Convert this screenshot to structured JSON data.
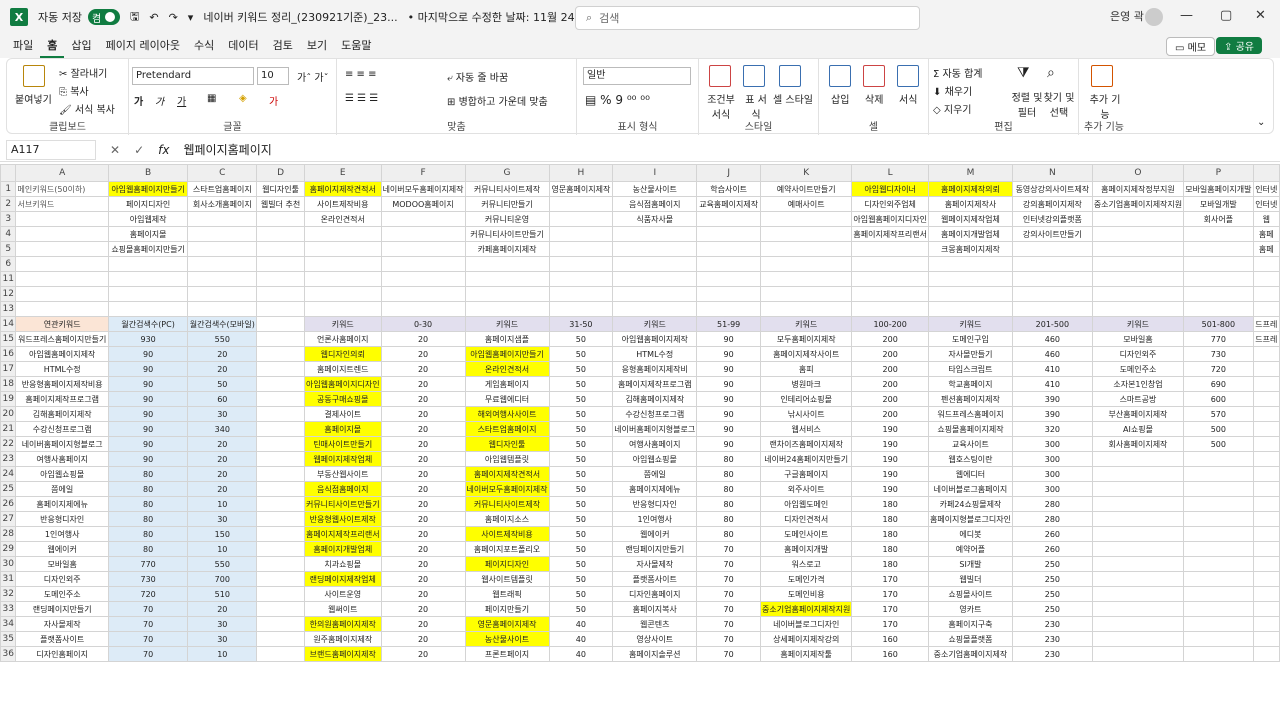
{
  "title": {
    "autosave": "자동 저장",
    "toggle": "켬",
    "filename": "네이버 키워드 정리_(230921기준)_23...",
    "modified": "• 마지막으로 수정한 날짜: 11월 24일",
    "search": "검색",
    "user": "은영 곽"
  },
  "menu": [
    "파일",
    "홈",
    "삽입",
    "페이지 레이아웃",
    "수식",
    "데이터",
    "검토",
    "보기",
    "도움말"
  ],
  "memo": "메모",
  "share": "공유",
  "ribbon": {
    "clipboard": {
      "paste": "붙여넣기",
      "cut": "잘라내기",
      "copy": "복사",
      "format": "서식 복사",
      "label": "클립보드"
    },
    "font": {
      "name": "Pretendard",
      "size": "10",
      "label": "글꼴"
    },
    "align": {
      "wrap": "자동 줄 바꿈",
      "merge": "병합하고 가운데 맞춤",
      "label": "맞춤"
    },
    "number": {
      "format": "일반",
      "label": "표시 형식"
    },
    "style": {
      "cond": "조건부 서식",
      "table": "표 서식",
      "cell": "셀 스타일",
      "label": "스타일"
    },
    "cells": {
      "insert": "삽입",
      "delete": "삭제",
      "format": "서식",
      "label": "셀"
    },
    "edit": {
      "sum": "자동 합계",
      "fill": "채우기",
      "clear": "지우기",
      "sort": "정렬 및 필터",
      "find": "찾기 및 선택",
      "label": "편집"
    },
    "addin": {
      "btn": "추가 기능",
      "label": "추가 기능"
    }
  },
  "formula": {
    "cell": "A117",
    "value": "웹페이지홈페이지"
  },
  "columns": [
    "A",
    "B",
    "C",
    "D",
    "E",
    "F",
    "G",
    "H",
    "I",
    "J",
    "K",
    "L",
    "M",
    "N",
    "O",
    "P",
    ""
  ],
  "top": [
    {
      "r": "1",
      "c": [
        "메인키워드(50이하)",
        "아임웹홈페이지만들기",
        "스타트업홈페이지",
        "웹디자인툴",
        "홈페이지제작견적서",
        "네이버모두홈페이지제작",
        "커뮤니티사이트제작",
        "영문홈페이지제작",
        "농산물사이트",
        "학습사이트",
        "예약사이트만들기",
        "아임웹디자이너",
        "홈페이지제작의뢰",
        "동영상강의사이트제작",
        "홈페이지제작정부지원",
        "모바일홈페이지개발",
        "인터넷"
      ]
    },
    {
      "r": "2",
      "c": [
        "서브키워드",
        "페이지디자인",
        "회사소개홈페이지",
        "웹빌더 추천",
        "사이트제작비용",
        "MODOO홈페이지",
        "커뮤니티만들기",
        "",
        "음식점홈페이지",
        "교육홈페이지제작",
        "예매사이트",
        "디자인외주업체",
        "홈페이지제작사",
        "강의홈페이지제작",
        "중소기업홈페이지제작지원",
        "모바일개발",
        "인터넷"
      ]
    },
    {
      "r": "3",
      "c": [
        "",
        "아임웹제작",
        "",
        "",
        "온라인견적서",
        "",
        "커뮤니티운영",
        "",
        "식품자사몰",
        "",
        "",
        "아임웹홈페이지디자인",
        "웹페이지제작업체",
        "인터넷강의플랫폼",
        "",
        "회사어플",
        "웹"
      ]
    },
    {
      "r": "4",
      "c": [
        "",
        "홈페이지몰",
        "",
        "",
        "",
        "",
        "커뮤니티사이트만들기",
        "",
        "",
        "",
        "",
        "홈페이지제작프리랜서",
        "홈페이지개발업체",
        "강의사이트만들기",
        "",
        "",
        "홈페"
      ]
    },
    {
      "r": "5",
      "c": [
        "",
        "쇼핑몰홈페이지만들기",
        "",
        "",
        "",
        "",
        "카페홈페이지제작",
        "",
        "",
        "",
        "",
        "",
        "크몽홈페이지제작",
        "",
        "",
        "",
        "홈페"
      ]
    },
    {
      "r": "6",
      "c": [
        "",
        "",
        "",
        "",
        "",
        "",
        "",
        "",
        "",
        "",
        "",
        "",
        "",
        "",
        "",
        "",
        ""
      ]
    }
  ],
  "gapRows": [
    "11",
    "12",
    "13"
  ],
  "tableHeader": {
    "r": "14",
    "c": [
      "연관키워드",
      "월간검색수(PC)",
      "월간검색수(모바일)",
      "",
      "키워드",
      "0-30",
      "키워드",
      "31-50",
      "키워드",
      "51-99",
      "키워드",
      "100-200",
      "키워드",
      "201-500",
      "키워드",
      "501-800",
      "드프레"
    ]
  },
  "rows": [
    {
      "r": "15",
      "c": [
        "워드프레스홈페이지만들기",
        "930",
        "550",
        "",
        "언론사홈페이지",
        "20",
        "홈페이지샘플",
        "50",
        "아임웹홈페이지제작",
        "90",
        "모두홈페이지제작",
        "200",
        "도메인구입",
        "460",
        "모바일홈",
        "770",
        "드프레"
      ]
    },
    {
      "r": "16",
      "c": [
        "아임웹홈페이지제작",
        "90",
        "20",
        "",
        "웹디자인의뢰",
        "20",
        "아임웹홈페이지만들기",
        "50",
        "HTML수정",
        "90",
        "홈페이지제작사이트",
        "200",
        "자사몰만들기",
        "460",
        "디자인외주",
        "730",
        ""
      ]
    },
    {
      "r": "17",
      "c": [
        "HTML수정",
        "90",
        "20",
        "",
        "홈페이지트렌드",
        "20",
        "온라인견적서",
        "50",
        "응형홈페이지제작비",
        "90",
        "홈피",
        "200",
        "타입스크립트",
        "410",
        "도메인주소",
        "720",
        ""
      ]
    },
    {
      "r": "18",
      "c": [
        "반응형홈페이지제작비용",
        "90",
        "50",
        "",
        "아임웹홈페이지디자인",
        "20",
        "게임홈페이지",
        "50",
        "홈페이지제작프로그램",
        "90",
        "병원마크",
        "200",
        "학교홈페이지",
        "410",
        "소자본1인창업",
        "690",
        ""
      ]
    },
    {
      "r": "19",
      "c": [
        "홈페이지제작프로그램",
        "90",
        "60",
        "",
        "공동구매쇼핑몰",
        "20",
        "무료웹에디터",
        "50",
        "김해홈페이지제작",
        "90",
        "인테리어쇼핑몰",
        "200",
        "펜션홈페이지제작",
        "390",
        "스마트공방",
        "600",
        ""
      ]
    },
    {
      "r": "20",
      "c": [
        "김해홈페이지제작",
        "90",
        "30",
        "",
        "결제사이트",
        "20",
        "해외여행사사이트",
        "50",
        "수강신청프로그램",
        "90",
        "낚시사이트",
        "200",
        "워드프레스홈페이지",
        "390",
        "부산홈페이지제작",
        "570",
        ""
      ]
    },
    {
      "r": "21",
      "c": [
        "수강신청프로그램",
        "90",
        "340",
        "",
        "홈페이지몰",
        "20",
        "스타트업홈페이지",
        "50",
        "네이버홈페이지형블로그",
        "90",
        "웹서비스",
        "190",
        "쇼핑몰홈페이지제작",
        "320",
        "AI쇼핑몰",
        "500",
        ""
      ]
    },
    {
      "r": "22",
      "c": [
        "네이버홈페이지형블로그",
        "90",
        "20",
        "",
        "틴매사이트만들기",
        "20",
        "웹디자인툴",
        "50",
        "여행사홈페이지",
        "90",
        "랜차이즈홈페이지제작",
        "190",
        "교육사이트",
        "300",
        "회사홈페이지제작",
        "500",
        ""
      ]
    },
    {
      "r": "23",
      "c": [
        "여행사홈페이지",
        "90",
        "20",
        "",
        "웹페이지제작업체",
        "20",
        "아임웹템플릿",
        "50",
        "아임웹쇼핑몰",
        "80",
        "네이버24홈페이지만들기",
        "190",
        "웹호스팅이란",
        "300",
        "",
        "",
        ""
      ]
    },
    {
      "r": "24",
      "c": [
        "아임웹쇼핑몰",
        "80",
        "20",
        "",
        "부동산웹사이트",
        "20",
        "홈페이지제작견적서",
        "50",
        "쯤에일",
        "80",
        "구글홈페이지",
        "190",
        "웹에디터",
        "300",
        "",
        "",
        ""
      ]
    },
    {
      "r": "25",
      "c": [
        "쯤에일",
        "80",
        "20",
        "",
        "음식점홈페이지",
        "20",
        "네이버모두홈페이지제작",
        "50",
        "홈페이지제에뉴",
        "80",
        "외주사이트",
        "190",
        "네이버블로그홈페이지",
        "300",
        "",
        "",
        ""
      ]
    },
    {
      "r": "26",
      "c": [
        "홈페이지제에뉴",
        "80",
        "10",
        "",
        "커뮤니티사이트만들기",
        "20",
        "커뮤니티사이트제작",
        "50",
        "반응형디자인",
        "80",
        "아임웹도메인",
        "180",
        "카페24쇼핑몰제작",
        "280",
        "",
        "",
        ""
      ]
    },
    {
      "r": "27",
      "c": [
        "반응형디자인",
        "80",
        "30",
        "",
        "반응형웹사이트제작",
        "20",
        "홈페이지소스",
        "50",
        "1인여행사",
        "80",
        "디자인견적서",
        "180",
        "홈페이지형블로그디자인",
        "280",
        "",
        "",
        ""
      ]
    },
    {
      "r": "28",
      "c": [
        "1인여행사",
        "80",
        "150",
        "",
        "홈페이지제작프리랜서",
        "20",
        "사이트제작비용",
        "50",
        "웹에이커",
        "80",
        "도메인사이트",
        "180",
        "에디봇",
        "260",
        "",
        "",
        ""
      ]
    },
    {
      "r": "29",
      "c": [
        "웹에이커",
        "80",
        "10",
        "",
        "홈페이지개발업체",
        "20",
        "홈페이지포트폴리오",
        "50",
        "랜딩페이지만들기",
        "70",
        "홈페이지개발",
        "180",
        "예약어플",
        "260",
        "",
        "",
        ""
      ]
    },
    {
      "r": "30",
      "c": [
        "모바일홈",
        "770",
        "550",
        "",
        "치과쇼핑몰",
        "20",
        "페이지디자인",
        "50",
        "자사몰제작",
        "70",
        "워스로고",
        "180",
        "SI개발",
        "250",
        "",
        "",
        ""
      ]
    },
    {
      "r": "31",
      "c": [
        "디자인외주",
        "730",
        "700",
        "",
        "랜딩페이지제작업체",
        "20",
        "웹사이트템플릿",
        "50",
        "플랫폼사이트",
        "70",
        "도메인가격",
        "170",
        "웹빌더",
        "250",
        "",
        "",
        ""
      ]
    },
    {
      "r": "32",
      "c": [
        "도메인주소",
        "720",
        "510",
        "",
        "사이트운영",
        "20",
        "웹트래픽",
        "50",
        "디자인홈페이지",
        "70",
        "도메인비용",
        "170",
        "쇼핑몰사이트",
        "250",
        "",
        "",
        ""
      ]
    },
    {
      "r": "33",
      "c": [
        "랜딩페이지만들기",
        "70",
        "20",
        "",
        "웹써이트",
        "20",
        "페이지만들기",
        "50",
        "홈페이지복사",
        "70",
        "중소기업홈페이지제작지원",
        "170",
        "영카트",
        "250",
        "",
        "",
        ""
      ]
    },
    {
      "r": "34",
      "c": [
        "자사몰제작",
        "70",
        "30",
        "",
        "한의원홈페이지제작",
        "20",
        "영문홈페이지제작",
        "40",
        "웹콘텐츠",
        "70",
        "네이버블로그디자인",
        "170",
        "홈페이지구축",
        "230",
        "",
        "",
        ""
      ]
    },
    {
      "r": "35",
      "c": [
        "플랫폼사이트",
        "70",
        "30",
        "",
        "원주홈페이지제작",
        "20",
        "농산물사이트",
        "40",
        "영상사이트",
        "70",
        "상세페이지제작강의",
        "160",
        "쇼핑몰플랫폼",
        "230",
        "",
        "",
        ""
      ]
    },
    {
      "r": "36",
      "c": [
        "디자인홈페이지",
        "70",
        "10",
        "",
        "브랜드홈페이지제작",
        "20",
        "프론트페이지",
        "40",
        "홈페이지솔루션",
        "70",
        "홈페이지제작툴",
        "160",
        "중소기업홈페이지제작",
        "230",
        "",
        "",
        ""
      ]
    }
  ],
  "yellowTop": [
    [
      1,
      1
    ],
    [
      1,
      4
    ],
    [
      1,
      11
    ],
    [
      1,
      12
    ]
  ],
  "yellowCells": [
    [
      16,
      4
    ],
    [
      18,
      4
    ],
    [
      19,
      4
    ],
    [
      21,
      4
    ],
    [
      22,
      4
    ],
    [
      23,
      4
    ],
    [
      25,
      4
    ],
    [
      26,
      4
    ],
    [
      27,
      4
    ],
    [
      28,
      4
    ],
    [
      29,
      4
    ],
    [
      31,
      4
    ],
    [
      34,
      4
    ],
    [
      36,
      4
    ],
    [
      16,
      6
    ],
    [
      17,
      6
    ],
    [
      20,
      6
    ],
    [
      21,
      6
    ],
    [
      22,
      6
    ],
    [
      24,
      6
    ],
    [
      25,
      6
    ],
    [
      26,
      6
    ],
    [
      28,
      6
    ],
    [
      30,
      6
    ],
    [
      34,
      6
    ],
    [
      35,
      6
    ],
    [
      33,
      10
    ]
  ]
}
